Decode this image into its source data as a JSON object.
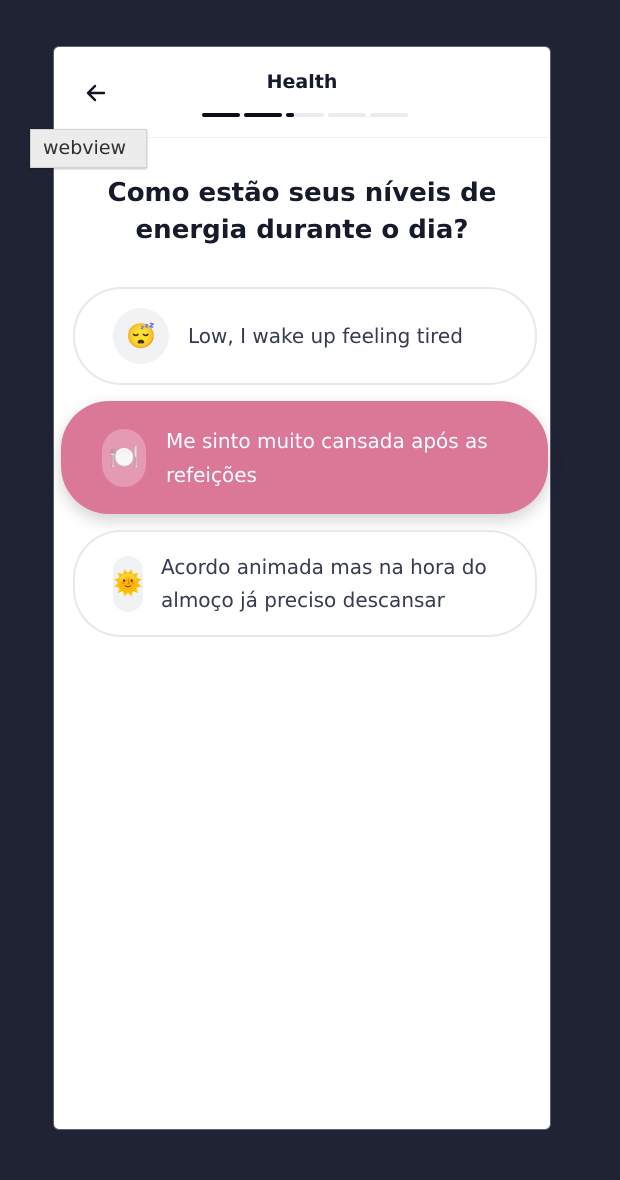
{
  "header": {
    "title": "Health",
    "back_icon": "arrow-left-icon",
    "progress": [
      1,
      1,
      0.2,
      0,
      0
    ]
  },
  "tooltip": {
    "label": "webview"
  },
  "question": {
    "text": "Como estão seus níveis de energia durante o dia?"
  },
  "options": [
    {
      "label": "Low, I wake up feeling tired",
      "icon": "sleeping-face-icon",
      "emoji": "😴",
      "selected": false
    },
    {
      "label": "Me sinto muito cansada após as refeições",
      "icon": "plate-with-cutlery-icon",
      "emoji": "🍽️",
      "selected": true
    },
    {
      "label": "Acordo animada mas na hora do almoço já preciso descansar",
      "icon": "sun-with-face-icon",
      "emoji": "🌞",
      "selected": false
    }
  ],
  "colors": {
    "background": "#1f2333",
    "selected_option": "#db7898",
    "title_text": "#161a2b",
    "progress_active": "#0b0d17",
    "progress_inactive": "#ebecef"
  }
}
